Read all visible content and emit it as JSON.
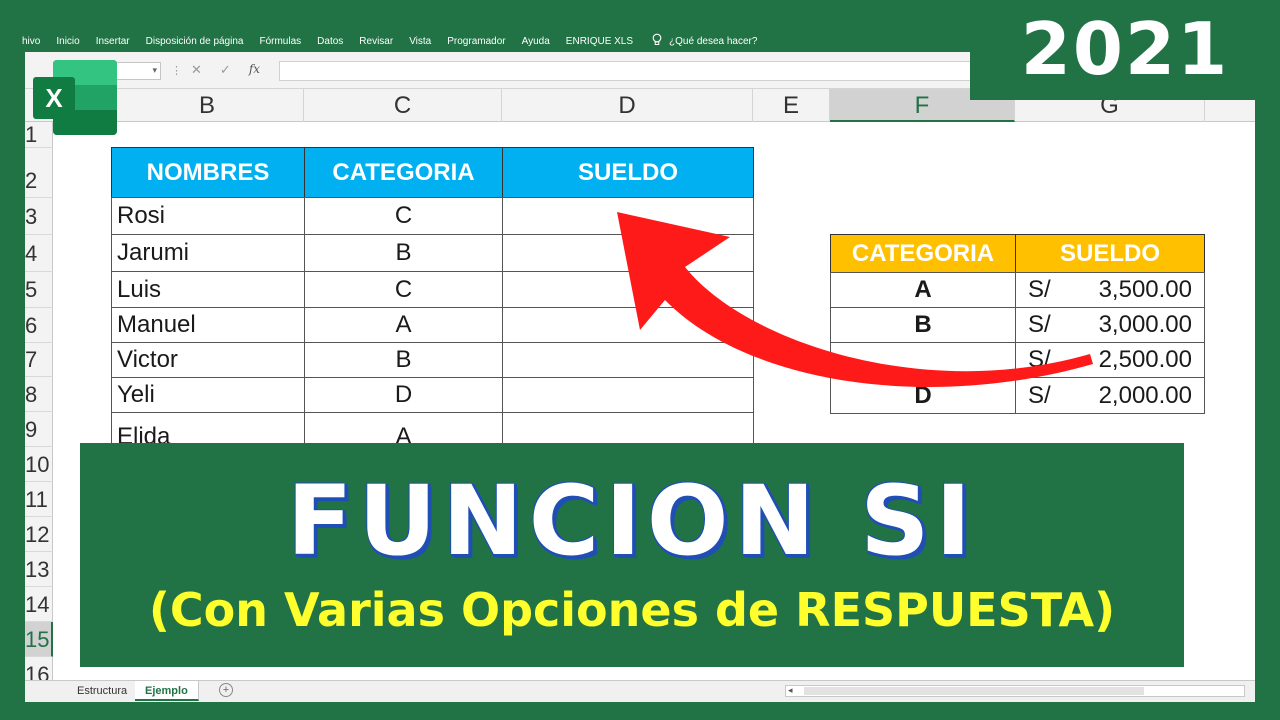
{
  "ribbon": {
    "items": [
      "hivo",
      "Inicio",
      "Insertar",
      "Disposición de página",
      "Fórmulas",
      "Datos",
      "Revisar",
      "Vista",
      "Programador",
      "Ayuda",
      "ENRIQUE XLS"
    ],
    "search": "¿Qué desea hacer?"
  },
  "formula_bar": {
    "fx": "fx",
    "cancel": "✕",
    "confirm": "✓"
  },
  "columns": [
    "B",
    "C",
    "D",
    "E",
    "F",
    "G"
  ],
  "rows": [
    "1",
    "2",
    "3",
    "4",
    "5",
    "6",
    "7",
    "8",
    "9",
    "10",
    "11",
    "12",
    "13",
    "14",
    "15",
    "16"
  ],
  "main_table": {
    "headers": [
      "NOMBRES",
      "CATEGORIA",
      "SUELDO"
    ],
    "rows": [
      {
        "name": "Rosi",
        "cat": "C"
      },
      {
        "name": "Jarumi",
        "cat": "B"
      },
      {
        "name": "Luis",
        "cat": "C"
      },
      {
        "name": "Manuel",
        "cat": "A"
      },
      {
        "name": "Victor",
        "cat": "B"
      },
      {
        "name": "Yeli",
        "cat": "D"
      },
      {
        "name": "Elida",
        "cat": "A"
      }
    ]
  },
  "lookup_table": {
    "headers": [
      "CATEGORIA",
      "SUELDO"
    ],
    "rows": [
      {
        "cat": "A",
        "cur": "S/",
        "amount": "3,500.00"
      },
      {
        "cat": "B",
        "cur": "S/",
        "amount": "3,000.00"
      },
      {
        "cat": "",
        "cur": "S/",
        "amount": "2,500.00"
      },
      {
        "cat": "D",
        "cur": "S/",
        "amount": "2,000.00"
      }
    ]
  },
  "tabs": [
    "Estructura",
    "Ejemplo"
  ],
  "year": "2021",
  "banner": {
    "title": "FUNCION SI",
    "subtitle": "(Con Varias Opciones de RESPUESTA)"
  },
  "logo_letter": "X",
  "colors": {
    "excel_green": "#217346",
    "header_blue": "#00b0f0",
    "header_orange": "#ffc000",
    "arrow_red": "#ff1a1a",
    "subtitle_yellow": "#ffff2e"
  }
}
